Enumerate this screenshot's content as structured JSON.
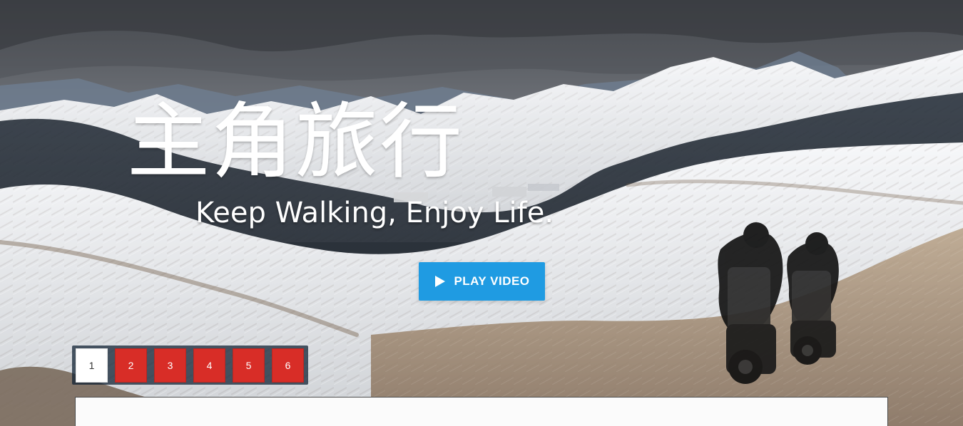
{
  "hero": {
    "title": "主角旅行",
    "subtitle": "Keep Walking, Enjoy Life.",
    "play_button": {
      "icon": "play-icon",
      "label": "PLAY VIDEO"
    },
    "pager": {
      "active": "1",
      "pages": [
        "1",
        "2",
        "3",
        "4",
        "5",
        "6"
      ]
    }
  },
  "colors": {
    "play_button_bg": "#1f9be2",
    "pager_bg": "#122334",
    "pager_active_bg": "#ffffff",
    "pager_inactive_bg": "#d82d27",
    "panel_bg": "#fbfbfb"
  }
}
